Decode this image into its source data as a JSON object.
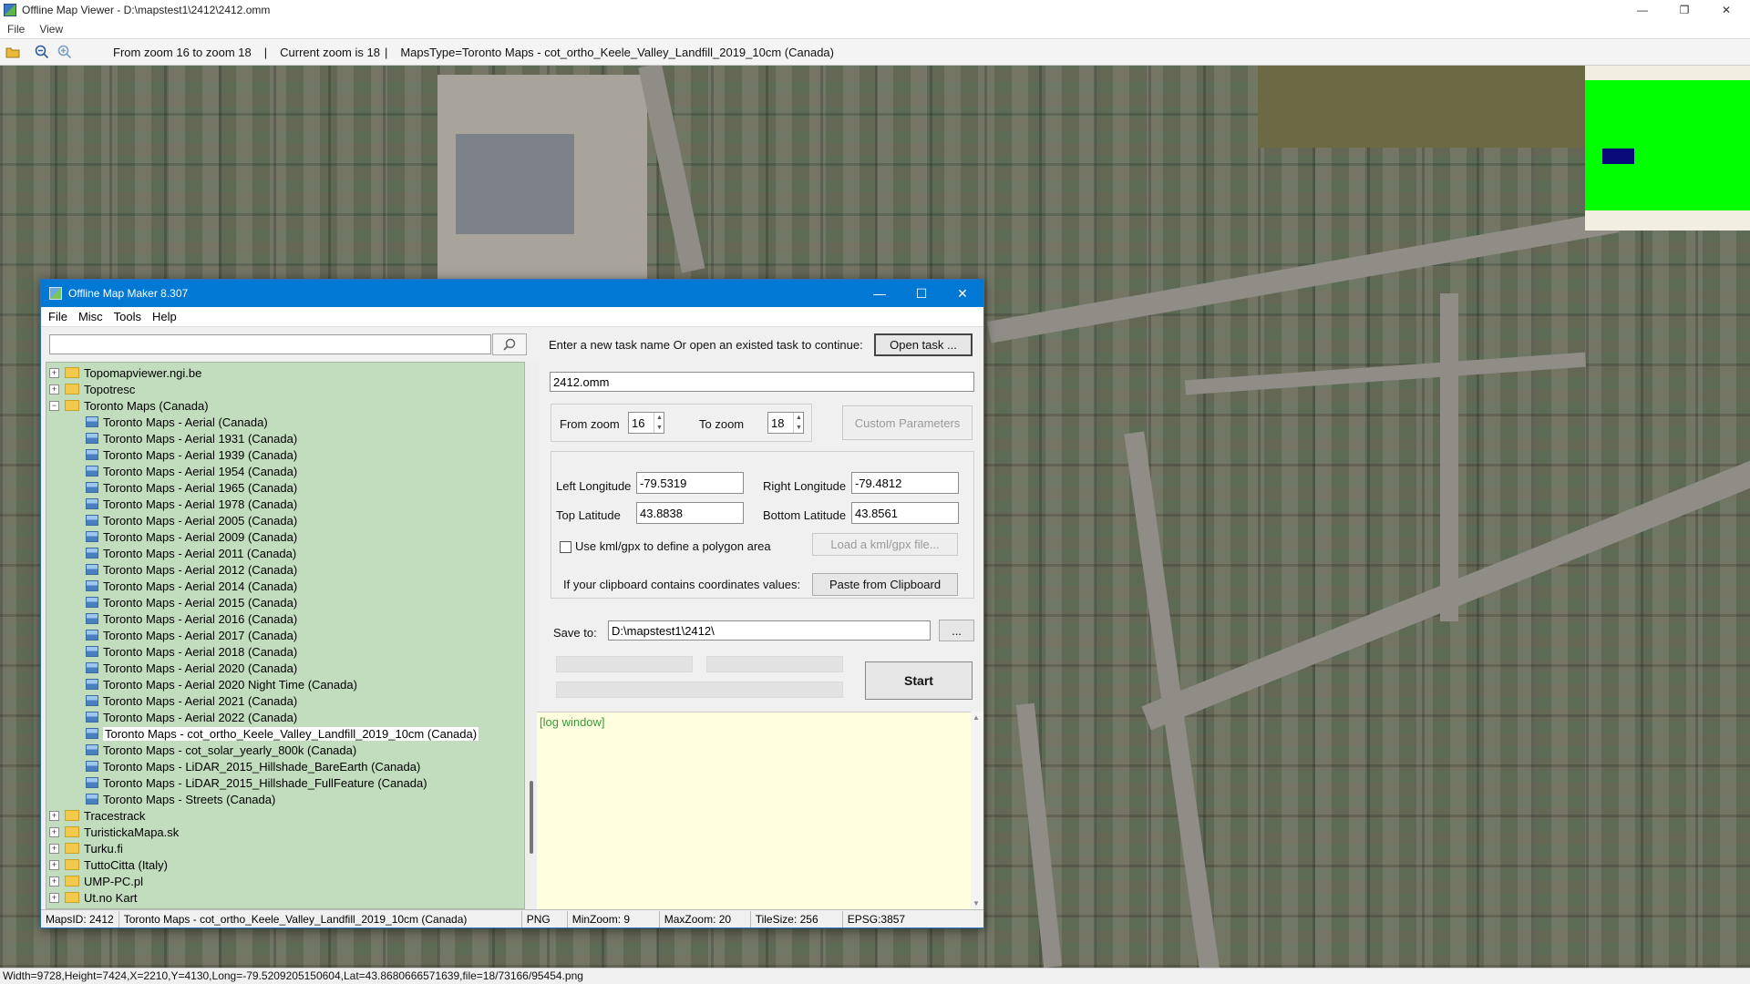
{
  "window": {
    "title": "Offline Map Viewer - D:\\mapstest1\\2412\\2412.omm",
    "controls": {
      "minimize": "—",
      "maximize": "❐",
      "close": "✕"
    }
  },
  "menu": [
    "File",
    "View"
  ],
  "toolbar": {
    "icons": [
      "open-folder-icon",
      "zoom-out-icon",
      "zoom-in-icon"
    ],
    "zoom_range": "From zoom 16 to zoom 18",
    "separator": "|",
    "current_zoom": "Current zoom is 18",
    "maps_type": "MapsType=Toronto Maps - cot_ortho_Keele_Valley_Landfill_2019_10cm (Canada)"
  },
  "status_bar": "Width=9728,Height=7424,X=2210,Y=4130,Long=-79.5209205150604,Lat=43.8680666571639,file=18/73166/95454.png",
  "overview": {
    "colors": {
      "background": "#f3efe0",
      "coverage": "#00ff00",
      "viewport": "#0a0a7a"
    }
  },
  "dialog": {
    "title": "Offline Map Maker 8.307",
    "controls": {
      "minimize": "—",
      "maximize": "☐",
      "close": "✕"
    },
    "menu": [
      "File",
      "Misc",
      "Tools",
      "Help"
    ],
    "search": {
      "value": "",
      "button_icon": "search-icon"
    },
    "tree": [
      {
        "label": "Topomapviewer.ngi.be",
        "type": "folder",
        "expanded": false
      },
      {
        "label": "Topotresc",
        "type": "folder",
        "expanded": false
      },
      {
        "label": "Toronto Maps (Canada)",
        "type": "folder",
        "expanded": true
      },
      {
        "label": "Toronto Maps - Aerial (Canada)",
        "type": "layer"
      },
      {
        "label": "Toronto Maps - Aerial 1931 (Canada)",
        "type": "layer"
      },
      {
        "label": "Toronto Maps - Aerial 1939 (Canada)",
        "type": "layer"
      },
      {
        "label": "Toronto Maps - Aerial 1954 (Canada)",
        "type": "layer"
      },
      {
        "label": "Toronto Maps - Aerial 1965 (Canada)",
        "type": "layer"
      },
      {
        "label": "Toronto Maps - Aerial 1978 (Canada)",
        "type": "layer"
      },
      {
        "label": "Toronto Maps - Aerial 2005 (Canada)",
        "type": "layer"
      },
      {
        "label": "Toronto Maps - Aerial 2009 (Canada)",
        "type": "layer"
      },
      {
        "label": "Toronto Maps - Aerial 2011 (Canada)",
        "type": "layer"
      },
      {
        "label": "Toronto Maps - Aerial 2012 (Canada)",
        "type": "layer"
      },
      {
        "label": "Toronto Maps - Aerial 2014 (Canada)",
        "type": "layer"
      },
      {
        "label": "Toronto Maps - Aerial 2015 (Canada)",
        "type": "layer"
      },
      {
        "label": "Toronto Maps - Aerial 2016 (Canada)",
        "type": "layer"
      },
      {
        "label": "Toronto Maps - Aerial 2017 (Canada)",
        "type": "layer"
      },
      {
        "label": "Toronto Maps - Aerial 2018 (Canada)",
        "type": "layer"
      },
      {
        "label": "Toronto Maps - Aerial 2020 (Canada)",
        "type": "layer"
      },
      {
        "label": "Toronto Maps - Aerial 2020 Night Time (Canada)",
        "type": "layer"
      },
      {
        "label": "Toronto Maps - Aerial 2021 (Canada)",
        "type": "layer"
      },
      {
        "label": "Toronto Maps - Aerial 2022 (Canada)",
        "type": "layer"
      },
      {
        "label": "Toronto Maps - cot_ortho_Keele_Valley_Landfill_2019_10cm (Canada)",
        "type": "layer",
        "selected": true
      },
      {
        "label": "Toronto Maps - cot_solar_yearly_800k (Canada)",
        "type": "layer"
      },
      {
        "label": "Toronto Maps - LiDAR_2015_Hillshade_BareEarth (Canada)",
        "type": "layer"
      },
      {
        "label": "Toronto Maps - LiDAR_2015_Hillshade_FullFeature (Canada)",
        "type": "layer"
      },
      {
        "label": "Toronto Maps - Streets (Canada)",
        "type": "layer"
      },
      {
        "label": "Tracestrack",
        "type": "folder",
        "expanded": false
      },
      {
        "label": "TuristickaMapa.sk",
        "type": "folder",
        "expanded": false
      },
      {
        "label": "Turku.fi",
        "type": "folder",
        "expanded": false
      },
      {
        "label": "TuttoCitta (Italy)",
        "type": "folder",
        "expanded": false
      },
      {
        "label": "UMP-PC.pl",
        "type": "folder",
        "expanded": false
      },
      {
        "label": "Ut.no Kart",
        "type": "folder",
        "expanded": false
      }
    ],
    "task_prompt": "Enter a new task name Or open an existed task to continue:",
    "open_task_label": "Open task ...",
    "task_name": "2412.omm",
    "from_zoom_label": "From zoom",
    "from_zoom_value": "16",
    "to_zoom_label": "To zoom",
    "to_zoom_value": "18",
    "custom_params_label": "Custom Parameters",
    "left_lon_label": "Left Longitude",
    "left_lon_value": "-79.5319",
    "right_lon_label": "Right Longitude",
    "right_lon_value": "-79.4812",
    "top_lat_label": "Top Latitude",
    "top_lat_value": "43.8838",
    "bottom_lat_label": "Bottom Latitude",
    "bottom_lat_value": "43.8561",
    "kml_label": "Use kml/gpx to define a polygon area",
    "kml_checked": false,
    "load_kml_label": "Load a kml/gpx file...",
    "clipboard_prompt": "If your clipboard contains coordinates values:",
    "paste_label": "Paste from Clipboard",
    "save_to_label": "Save to:",
    "save_to_value": "D:\\mapstest1\\2412\\",
    "browse_label": "...",
    "start_label": "Start",
    "log_text": "[log window]",
    "status": {
      "maps_id": "MapsID: 2412",
      "map_name": "Toronto Maps - cot_ortho_Keele_Valley_Landfill_2019_10cm (Canada)",
      "format": "PNG",
      "min_zoom": "MinZoom: 9",
      "max_zoom": "MaxZoom: 20",
      "tile_size": "TileSize: 256",
      "epsg": "EPSG:3857"
    }
  }
}
